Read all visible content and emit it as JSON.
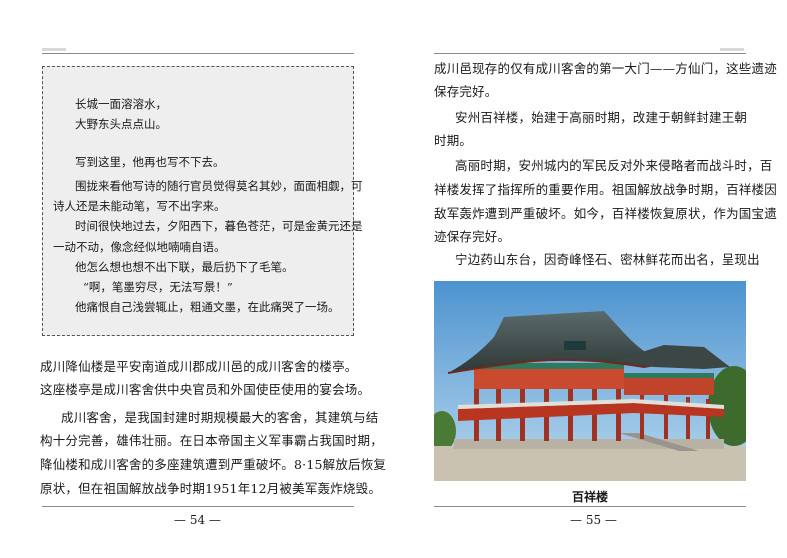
{
  "left_page": {
    "box_lines": [
      "长城一面溶溶水，",
      "大野东头点点山。",
      "写到这里，他再也写不下去。",
      "围拢来看他写诗的随行官员觉得莫名其妙，面面相觑，可",
      "诗人还是未能动笔，写不出字来。",
      "时间很快地过去，夕阳西下，暮色苍茫，可是金黄元还是",
      "一动不动，像念经似地喃喃自语。",
      "他怎么想也想不出下联，最后扔下了毛笔。",
      "“啊，笔墨穷尽，无法写景！”",
      "他痛恨自己浅尝辄止，粗通文墨，在此痛哭了一场。"
    ],
    "body_lines": [
      "成川降仙楼是平安南道成川郡成川邑的成川客舍的楼亭。",
      "这座楼亭是成川客舍供中央官员和外国使臣使用的宴会场。",
      "成川客舍，是我国封建时期规模最大的客舍，其建筑与结",
      "构十分完善，雄伟壮丽。在日本帝国主义军事霸占我国时期，",
      "降仙楼和成川客舍的多座建筑遭到严重破坏。8·15解放后恢复",
      "原状，但在祖国解放战争时期1951年12月被美军轰炸烧毁。"
    ],
    "page_number": "— 54 —"
  },
  "right_page": {
    "body_lines": [
      "成川邑现存的仅有成川客舍的第一大门——方仙门，这些遗迹",
      "保存完好。",
      "安州百祥楼，始建于高丽时期，改建于朝鲜封建王朝",
      "时期。",
      "高丽时期，安州城内的军民反对外来侵略者而战斗时，百",
      "祥楼发挥了指挥所的重要作用。祖国解放战争时期，百祥楼因",
      "敌军轰炸遭到严重破坏。如今，百祥楼恢复原状，作为国宝遗",
      "迹保存完好。",
      "宁边药山东台，因奇峰怪石、密林鲜花而出名，呈现出"
    ],
    "photo_caption": "百祥楼",
    "page_number": "— 55 —"
  }
}
